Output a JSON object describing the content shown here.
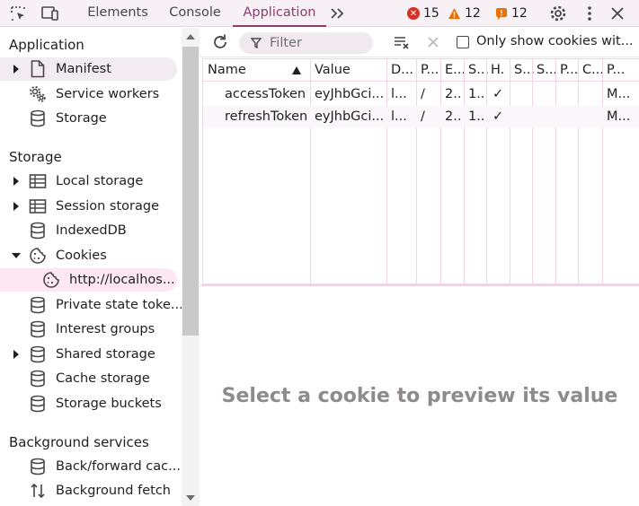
{
  "topbar": {
    "tabs": [
      {
        "label": "Elements"
      },
      {
        "label": "Console"
      },
      {
        "label": "Application"
      }
    ],
    "errors": "15",
    "warnings": "12",
    "issues": "12",
    "colors": {
      "active": "#8b3c6e",
      "error": "#d93025",
      "warning": "#e8710a",
      "issue": "#e8710a"
    }
  },
  "sidebar": {
    "application_title": "Application",
    "app_items": [
      {
        "label": "Manifest",
        "icon": "document-icon"
      },
      {
        "label": "Service workers",
        "icon": "gears-icon"
      },
      {
        "label": "Storage",
        "icon": "database-icon"
      }
    ],
    "storage_title": "Storage",
    "storage_items": [
      {
        "label": "Local storage",
        "icon": "table-icon"
      },
      {
        "label": "Session storage",
        "icon": "table-icon"
      },
      {
        "label": "IndexedDB",
        "icon": "database-icon"
      },
      {
        "label": "Cookies",
        "icon": "cookie-icon"
      },
      {
        "label": "http://localhos...",
        "icon": "cookie-icon"
      },
      {
        "label": "Private state toke...",
        "icon": "database-icon"
      },
      {
        "label": "Interest groups",
        "icon": "database-icon"
      },
      {
        "label": "Shared storage",
        "icon": "database-icon"
      },
      {
        "label": "Cache storage",
        "icon": "database-icon"
      },
      {
        "label": "Storage buckets",
        "icon": "database-icon"
      }
    ],
    "bg_title": "Background services",
    "bg_items": [
      {
        "label": "Back/forward cac...",
        "icon": "database-icon"
      },
      {
        "label": "Background fetch",
        "icon": "arrows-updown-icon"
      }
    ]
  },
  "toolbar": {
    "filter_placeholder": "Filter",
    "only_show_label": "Only show cookies wit..."
  },
  "table": {
    "headers": [
      "Name",
      "Value",
      "D...",
      "P...",
      "E...",
      "S...",
      "H.",
      "S...",
      "S...",
      "P...",
      "C...",
      "P..."
    ],
    "rows": [
      [
        "accessToken",
        "eyJhbGci...",
        "l...",
        "/",
        "2...",
        "1...",
        "✓",
        "",
        "",
        "",
        "",
        "M..."
      ],
      [
        "refreshToken",
        "eyJhbGci...",
        "l...",
        "/",
        "2...",
        "1...",
        "✓",
        "",
        "",
        "",
        "",
        "M..."
      ]
    ]
  },
  "preview": {
    "message": "Select a cookie to preview its value"
  }
}
